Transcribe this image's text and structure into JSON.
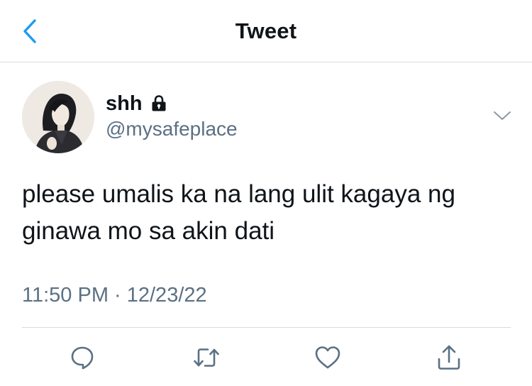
{
  "header": {
    "title": "Tweet",
    "back_icon": "chevron-left-icon",
    "accent_color": "#1d9bf0"
  },
  "tweet": {
    "user": {
      "name": "shh",
      "handle": "@mysafeplace",
      "protected_icon": "lock-icon",
      "avatar_icon": "avatar"
    },
    "text_line1": "please umalis ka na lang ulit kagaya ng",
    "text_line2": "ginawa mo sa akin dati",
    "timestamp": "11:50 PM · 12/23/22",
    "menu_icon": "chevron-down-icon"
  },
  "actions": {
    "reply_icon": "reply-icon",
    "retweet_icon": "retweet-icon",
    "like_icon": "heart-icon",
    "share_icon": "share-icon",
    "icon_color": "#5b7083"
  }
}
